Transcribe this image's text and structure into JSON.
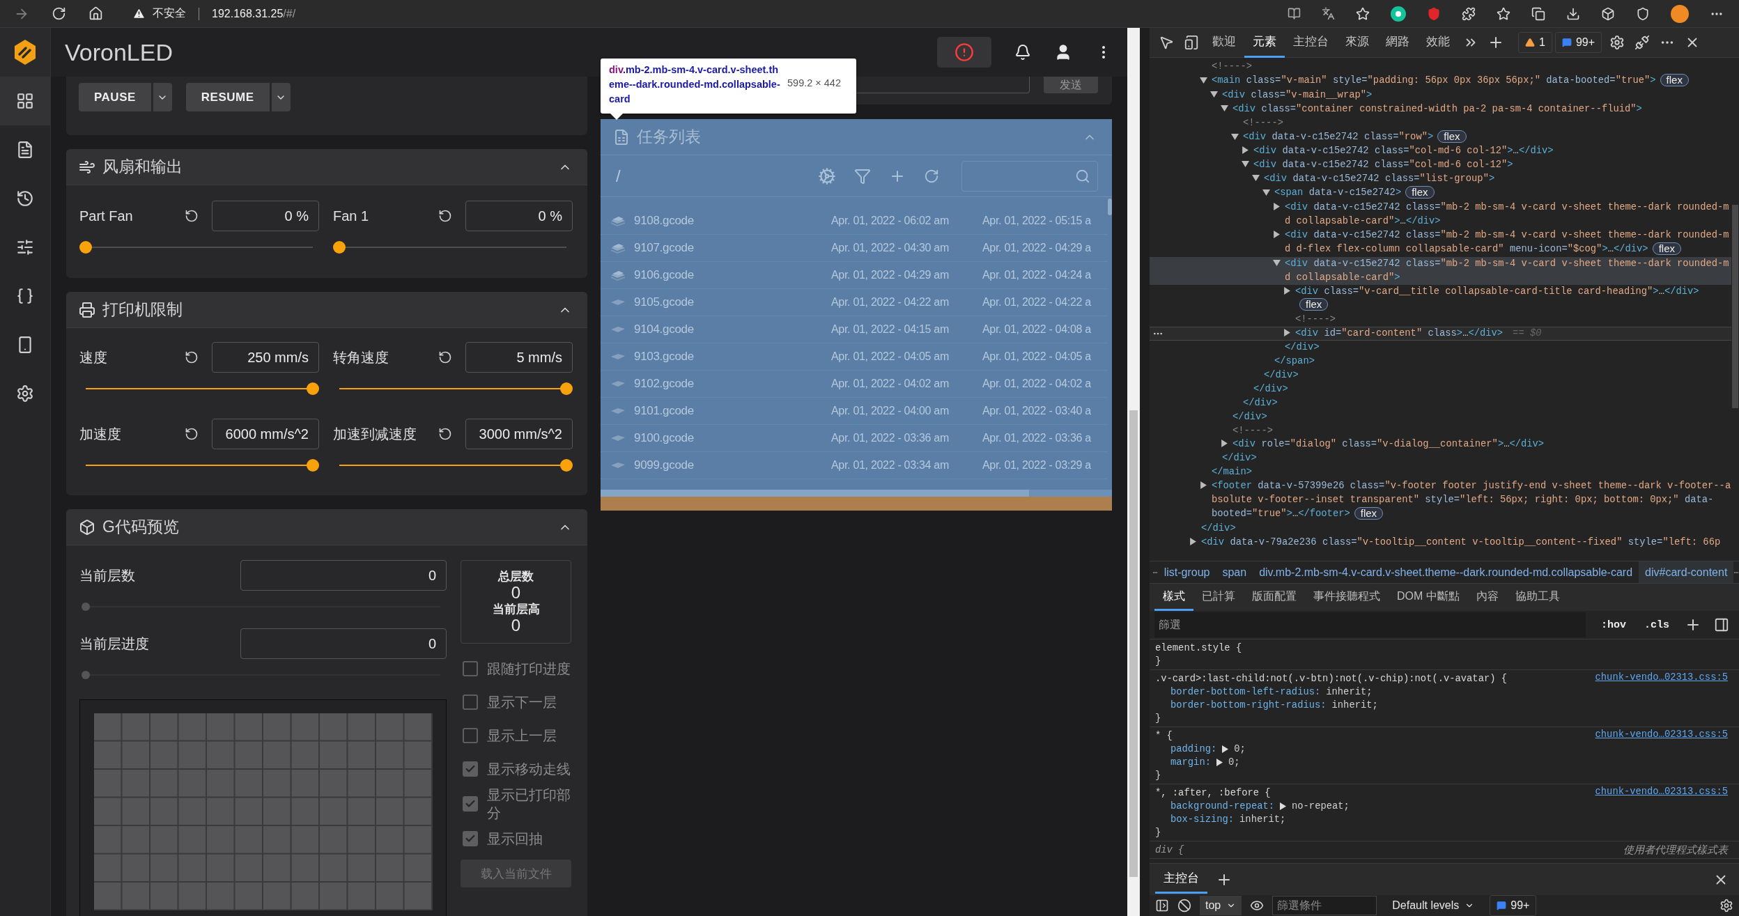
{
  "browser": {
    "warning": "不安全",
    "address_host": "192.168.31.25",
    "address_path": "/#/"
  },
  "app": {
    "title": "VoronLED"
  },
  "sidebar": {
    "items": [
      {
        "kind": "dashboard",
        "selected": true
      },
      {
        "kind": "files",
        "selected": false
      },
      {
        "kind": "history",
        "selected": false
      },
      {
        "kind": "tune",
        "selected": false
      },
      {
        "kind": "macros",
        "selected": false
      },
      {
        "kind": "machine",
        "selected": false
      },
      {
        "kind": "settings",
        "selected": false
      }
    ]
  },
  "print_controls": {
    "buttons": [
      "PAUSE",
      "RESUME"
    ]
  },
  "fans_card": {
    "title": "风扇和输出",
    "expanded": true,
    "controls": [
      {
        "name": "Part Fan",
        "value": "0 %",
        "level": 0,
        "disabled": false
      },
      {
        "name": "Fan 1",
        "value": "0 %",
        "level": 0,
        "disabled": false
      }
    ]
  },
  "limits_card": {
    "title": "打印机限制",
    "expanded": true,
    "controls": [
      {
        "name": "速度",
        "value": "250 mm/s",
        "level": 1,
        "disabled": false
      },
      {
        "name": "转角速度",
        "value": "5 mm/s",
        "level": 1,
        "disabled": false
      },
      {
        "name": "加速度",
        "value": "6000 mm/s^2",
        "level": 1,
        "disabled": false
      },
      {
        "name": "加速到减速度",
        "value": "3000 mm/s^2",
        "level": 1,
        "disabled": false
      }
    ]
  },
  "gcode_card": {
    "title": "G代码预览",
    "expanded": true,
    "fields": [
      {
        "name": "当前层数",
        "value": "0",
        "level": 0,
        "disabled": true
      },
      {
        "name": "当前层进度",
        "value": "0",
        "level": 0,
        "disabled": true
      }
    ],
    "stats": [
      {
        "label": "总层数",
        "value": "0"
      },
      {
        "label": "当前层高",
        "value": "0"
      }
    ],
    "options": [
      {
        "label": "跟随打印进度",
        "checked": false
      },
      {
        "label": "显示下一层",
        "checked": false
      },
      {
        "label": "显示上一层",
        "checked": false
      },
      {
        "label": "显示移动走线",
        "checked": true
      },
      {
        "label": "显示已打印部分",
        "checked": true
      },
      {
        "label": "显示回抽",
        "checked": true
      }
    ],
    "load_button": "载入当前文件"
  },
  "console_card": {
    "send_button": "发送"
  },
  "inspect_tooltip": {
    "tag": "div",
    "classes": ".mb-2.mb-sm-4.v-card.v-sheet.theme--dark.rounded-md.collapsable-card",
    "size": "599.2 × 442"
  },
  "task_list": {
    "title": "任务列表",
    "expanded": true,
    "path": "/",
    "rows": [
      {
        "name": "9108.gcode",
        "column_2": "Apr. 01, 2022 - 06:02 am",
        "column_3": "Apr. 01, 2022 - 05:15 a",
        "kind": "stack"
      },
      {
        "name": "9107.gcode",
        "column_2": "Apr. 01, 2022 - 04:30 am",
        "column_3": "Apr. 01, 2022 - 04:29 a",
        "kind": "stack"
      },
      {
        "name": "9106.gcode",
        "column_2": "Apr. 01, 2022 - 04:29 am",
        "column_3": "Apr. 01, 2022 - 04:24 a",
        "kind": "stack"
      },
      {
        "name": "9105.gcode",
        "column_2": "Apr. 01, 2022 - 04:22 am",
        "column_3": "Apr. 01, 2022 - 04:22 a",
        "kind": "flat"
      },
      {
        "name": "9104.gcode",
        "column_2": "Apr. 01, 2022 - 04:15 am",
        "column_3": "Apr. 01, 2022 - 04:08 a",
        "kind": "flat"
      },
      {
        "name": "9103.gcode",
        "column_2": "Apr. 01, 2022 - 04:05 am",
        "column_3": "Apr. 01, 2022 - 04:05 a",
        "kind": "flat"
      },
      {
        "name": "9102.gcode",
        "column_2": "Apr. 01, 2022 - 04:02 am",
        "column_3": "Apr. 01, 2022 - 04:02 a",
        "kind": "flat"
      },
      {
        "name": "9101.gcode",
        "column_2": "Apr. 01, 2022 - 04:00 am",
        "column_3": "Apr. 01, 2022 - 03:40 a",
        "kind": "flat"
      },
      {
        "name": "9100.gcode",
        "column_2": "Apr. 01, 2022 - 03:36 am",
        "column_3": "Apr. 01, 2022 - 03:36 a",
        "kind": "flat"
      },
      {
        "name": "9099.gcode",
        "column_2": "Apr. 01, 2022 - 03:34 am",
        "column_3": "Apr. 01, 2022 - 03:29 a",
        "kind": "flat"
      }
    ]
  },
  "devtools": {
    "tabs": [
      {
        "label": "歡迎",
        "selected": false
      },
      {
        "label": "元素",
        "selected": true
      },
      {
        "label": "主控台",
        "selected": false
      },
      {
        "label": "來源",
        "selected": false
      },
      {
        "label": "網路",
        "selected": false
      },
      {
        "label": "效能",
        "selected": false
      }
    ],
    "warnings": "1",
    "messages": "99+",
    "dom_tree": [
      {
        "close": "</div>",
        "children": [
          {
            "selected": false,
            "highlighted": false,
            "parts": [
              {
                "kind": "comment",
                "text": "<!---->"
              }
            ]
          },
          {
            "selected": false,
            "highlighted": false,
            "expanded": true,
            "parts": [
              {
                "kind": "tag",
                "text": "<main"
              },
              {
                "kind": "attr",
                "text": " class="
              },
              {
                "kind": "val",
                "text": "\"v-main\""
              },
              {
                "kind": "attr",
                "text": " style="
              },
              {
                "kind": "val",
                "text": "\"padding: 56px 0px 36px 56px;\""
              },
              {
                "kind": "attr",
                "text": " data-booted="
              },
              {
                "kind": "val",
                "text": "\"true\""
              },
              {
                "kind": "tag",
                "text": ">"
              }
            ],
            "badge": "flex",
            "close": "</main>",
            "children": [
              {
                "selected": false,
                "highlighted": false,
                "expanded": true,
                "parts": [
                  {
                    "kind": "tag",
                    "text": "<div"
                  },
                  {
                    "kind": "attr",
                    "text": " class="
                  },
                  {
                    "kind": "val",
                    "text": "\"v-main__wrap\""
                  },
                  {
                    "kind": "tag",
                    "text": ">"
                  }
                ],
                "close": "</div>",
                "children": [
                  {
                    "selected": false,
                    "highlighted": false,
                    "expanded": true,
                    "parts": [
                      {
                        "kind": "tag",
                        "text": "<div"
                      },
                      {
                        "kind": "attr",
                        "text": " class="
                      },
                      {
                        "kind": "val",
                        "text": "\"container constrained-width pa-2 pa-sm-4 container--fluid\""
                      },
                      {
                        "kind": "tag",
                        "text": ">"
                      }
                    ],
                    "close": "</div>",
                    "children": [
                      {
                        "selected": false,
                        "highlighted": false,
                        "parts": [
                          {
                            "kind": "comment",
                            "text": "<!---->"
                          }
                        ]
                      },
                      {
                        "selected": false,
                        "highlighted": false,
                        "expanded": true,
                        "parts": [
                          {
                            "kind": "tag",
                            "text": "<div"
                          },
                          {
                            "kind": "attr",
                            "text": " data-v-c15e2742 class="
                          },
                          {
                            "kind": "val",
                            "text": "\"row\""
                          },
                          {
                            "kind": "tag",
                            "text": ">"
                          }
                        ],
                        "badge": "flex",
                        "close": "</div>",
                        "children": [
                          {
                            "selected": false,
                            "highlighted": false,
                            "expanded": false,
                            "parts": [
                              {
                                "kind": "tag",
                                "text": "<div"
                              },
                              {
                                "kind": "attr",
                                "text": " data-v-c15e2742 class="
                              },
                              {
                                "kind": "val",
                                "text": "\"col-md-6 col-12\""
                              },
                              {
                                "kind": "tag",
                                "text": ">"
                              },
                              {
                                "kind": "plain",
                                "text": "…"
                              },
                              {
                                "kind": "tag",
                                "text": "</div>"
                              }
                            ]
                          },
                          {
                            "selected": false,
                            "highlighted": false,
                            "expanded": true,
                            "parts": [
                              {
                                "kind": "tag",
                                "text": "<div"
                              },
                              {
                                "kind": "attr",
                                "text": " data-v-c15e2742 class="
                              },
                              {
                                "kind": "val",
                                "text": "\"col-md-6 col-12\""
                              },
                              {
                                "kind": "tag",
                                "text": ">"
                              }
                            ],
                            "close": "</div>",
                            "children": [
                              {
                                "selected": false,
                                "highlighted": false,
                                "expanded": true,
                                "parts": [
                                  {
                                    "kind": "tag",
                                    "text": "<div"
                                  },
                                  {
                                    "kind": "attr",
                                    "text": " data-v-c15e2742 class="
                                  },
                                  {
                                    "kind": "val",
                                    "text": "\"list-group\""
                                  },
                                  {
                                    "kind": "tag",
                                    "text": ">"
                                  }
                                ],
                                "close": "</div>",
                                "children": [
                                  {
                                    "selected": false,
                                    "highlighted": false,
                                    "expanded": true,
                                    "parts": [
                                      {
                                        "kind": "tag",
                                        "text": "<span"
                                      },
                                      {
                                        "kind": "attr",
                                        "text": " data-v-c15e2742"
                                      },
                                      {
                                        "kind": "tag",
                                        "text": ">"
                                      }
                                    ],
                                    "badge": "flex",
                                    "close": "</span>",
                                    "children": [
                                      {
                                        "selected": false,
                                        "highlighted": false,
                                        "expanded": false,
                                        "lines": [
                                          [
                                            {
                                              "kind": "tag",
                                              "text": "<div"
                                            },
                                            {
                                              "kind": "attr",
                                              "text": " data-v-c15e2742 class="
                                            },
                                            {
                                              "kind": "val",
                                              "text": "\"mb-2 mb-sm-4 v-card v-sheet theme--dark rounded-m"
                                            }
                                          ],
                                          [
                                            {
                                              "kind": "val",
                                              "text": "d collapsable-card\""
                                            },
                                            {
                                              "kind": "tag",
                                              "text": ">"
                                            },
                                            {
                                              "kind": "plain",
                                              "text": "…"
                                            },
                                            {
                                              "kind": "tag",
                                              "text": "</div>"
                                            }
                                          ]
                                        ]
                                      },
                                      {
                                        "selected": false,
                                        "highlighted": false,
                                        "expanded": false,
                                        "lines": [
                                          [
                                            {
                                              "kind": "tag",
                                              "text": "<div"
                                            },
                                            {
                                              "kind": "attr",
                                              "text": " data-v-c15e2742 class="
                                            },
                                            {
                                              "kind": "val",
                                              "text": "\"mb-2 mb-sm-4 v-card v-sheet theme--dark rounded-m"
                                            }
                                          ],
                                          [
                                            {
                                              "kind": "val",
                                              "text": "d d-flex flex-column collapsable-card\""
                                            },
                                            {
                                              "kind": "attr",
                                              "text": " menu-icon="
                                            },
                                            {
                                              "kind": "val",
                                              "text": "\"$cog\""
                                            },
                                            {
                                              "kind": "tag",
                                              "text": ">"
                                            },
                                            {
                                              "kind": "plain",
                                              "text": "…"
                                            },
                                            {
                                              "kind": "tag",
                                              "text": "</div>"
                                            }
                                          ]
                                        ],
                                        "badge": "flex"
                                      },
                                      {
                                        "selected": false,
                                        "highlighted": true,
                                        "expanded": true,
                                        "lines": [
                                          [
                                            {
                                              "kind": "tag",
                                              "text": "<div"
                                            },
                                            {
                                              "kind": "attr",
                                              "text": " data-v-c15e2742 class="
                                            },
                                            {
                                              "kind": "val",
                                              "text": "\"mb-2 mb-sm-4 v-card v-sheet theme--dark rounded-m"
                                            }
                                          ],
                                          [
                                            {
                                              "kind": "val",
                                              "text": "d collapsable-card\""
                                            },
                                            {
                                              "kind": "tag",
                                              "text": ">"
                                            }
                                          ]
                                        ],
                                        "close": "</div>",
                                        "children": [
                                          {
                                            "selected": false,
                                            "highlighted": false,
                                            "expanded": false,
                                            "parts": [
                                              {
                                                "kind": "tag",
                                                "text": "<div"
                                              },
                                              {
                                                "kind": "attr",
                                                "text": " class="
                                              },
                                              {
                                                "kind": "val",
                                                "text": "\"v-card__title collapsable-card-title card-heading\""
                                              },
                                              {
                                                "kind": "tag",
                                                "text": ">"
                                              },
                                              {
                                                "kind": "plain",
                                                "text": "…"
                                              },
                                              {
                                                "kind": "tag",
                                                "text": "</div>"
                                              }
                                            ],
                                            "badge": "flex"
                                          },
                                          {
                                            "selected": false,
                                            "highlighted": false,
                                            "parts": [
                                              {
                                                "kind": "comment",
                                                "text": "<!---->"
                                              }
                                            ]
                                          },
                                          {
                                            "selected": true,
                                            "highlighted": false,
                                            "expanded": false,
                                            "parts": [
                                              {
                                                "kind": "tag",
                                                "text": "<div"
                                              },
                                              {
                                                "kind": "attr",
                                                "text": " id="
                                              },
                                              {
                                                "kind": "val",
                                                "text": "\"card-content\""
                                              },
                                              {
                                                "kind": "attr",
                                                "text": " class"
                                              },
                                              {
                                                "kind": "tag",
                                                "text": ">"
                                              },
                                              {
                                                "kind": "plain",
                                                "text": "…"
                                              },
                                              {
                                                "kind": "tag",
                                                "text": "</div>"
                                              }
                                            ],
                                            "suffix": "== $0"
                                          }
                                        ]
                                      }
                                    ]
                                  }
                                ]
                              }
                            ]
                          }
                        ]
                      }
                    ]
                  },
                  {
                    "selected": false,
                    "highlighted": false,
                    "parts": [
                      {
                        "kind": "comment",
                        "text": "<!---->"
                      }
                    ]
                  },
                  {
                    "selected": false,
                    "highlighted": false,
                    "expanded": false,
                    "parts": [
                      {
                        "kind": "tag",
                        "text": "<div"
                      },
                      {
                        "kind": "attr",
                        "text": " role="
                      },
                      {
                        "kind": "val",
                        "text": "\"dialog\""
                      },
                      {
                        "kind": "attr",
                        "text": " class="
                      },
                      {
                        "kind": "val",
                        "text": "\"v-dialog__container\""
                      },
                      {
                        "kind": "tag",
                        "text": ">"
                      },
                      {
                        "kind": "plain",
                        "text": "…"
                      },
                      {
                        "kind": "tag",
                        "text": "</div>"
                      }
                    ]
                  }
                ]
              }
            ]
          },
          {
            "selected": false,
            "highlighted": false,
            "expanded": false,
            "lines": [
              [
                {
                  "kind": "tag",
                  "text": "<footer"
                },
                {
                  "kind": "attr",
                  "text": " data-v-57399e26 class="
                },
                {
                  "kind": "val",
                  "text": "\"v-footer footer justify-end v-sheet theme--dark v-footer--a"
                }
              ],
              [
                {
                  "kind": "val",
                  "text": "bsolute v-footer--inset transparent\""
                },
                {
                  "kind": "attr",
                  "text": " style="
                },
                {
                  "kind": "val",
                  "text": "\"left: 56px; right: 0px; bottom: 0px;\""
                },
                {
                  "kind": "attr",
                  "text": " data-"
                }
              ],
              [
                {
                  "kind": "attr",
                  "text": "booted="
                },
                {
                  "kind": "val",
                  "text": "\"true\""
                },
                {
                  "kind": "tag",
                  "text": ">"
                },
                {
                  "kind": "plain",
                  "text": "…"
                },
                {
                  "kind": "tag",
                  "text": "</footer>"
                }
              ]
            ],
            "badge": "flex"
          }
        ]
      },
      {
        "selected": false,
        "highlighted": false,
        "expanded": false,
        "parts": [
          {
            "kind": "tag",
            "text": "<div"
          },
          {
            "kind": "attr",
            "text": " data-v-79a2e236 class="
          },
          {
            "kind": "val",
            "text": "\"v-tooltip__content v-tooltip__content--fixed\""
          },
          {
            "kind": "attr",
            "text": " style="
          },
          {
            "kind": "val",
            "text": "\"left: 66p"
          }
        ]
      }
    ],
    "breadcrumbs": [
      {
        "label": "list-group",
        "selected": false
      },
      {
        "label": "span",
        "selected": false
      },
      {
        "label": "div.mb-2.mb-sm-4.v-card.v-sheet.theme--dark.rounded-md.collapsable-card",
        "selected": false
      },
      {
        "label": "div#card-content",
        "selected": true
      }
    ],
    "style_tabs": [
      {
        "label": "樣式",
        "selected": true
      },
      {
        "label": "已計算",
        "selected": false
      },
      {
        "label": "版面配置",
        "selected": false
      },
      {
        "label": "事件接聽程式",
        "selected": false
      },
      {
        "label": "DOM 中斷點",
        "selected": false
      },
      {
        "label": "內容",
        "selected": false
      },
      {
        "label": "協助工具",
        "selected": false
      }
    ],
    "filter_placeholder": "篩選",
    "hov": ":hov",
    "cls": ".cls",
    "rules": [
      {
        "kind": "inline",
        "selector": "element.style {",
        "close": "}"
      },
      {
        "kind": "author",
        "selector": ".v-card>:last-child:not(.v-btn):not(.v-chip):not(.v-avatar) {",
        "source": "chunk-vendo…02313.css:5",
        "close": "}",
        "props": [
          {
            "name": "border-bottom-left-radius:",
            "value": "inherit;",
            "expandable": false
          },
          {
            "name": "border-bottom-right-radius:",
            "value": "inherit;",
            "expandable": false
          }
        ]
      },
      {
        "kind": "author",
        "selector": "* {",
        "source": "chunk-vendo…02313.css:5",
        "close": "}",
        "props": [
          {
            "name": "padding:",
            "value": "0;",
            "expandable": true
          },
          {
            "name": "margin:",
            "value": "0;",
            "expandable": true
          }
        ]
      },
      {
        "kind": "author",
        "selector": "*, :after, :before {",
        "source": "chunk-vendo…02313.css:5",
        "close": "}",
        "props": [
          {
            "name": "background-repeat:",
            "value": "no-repeat;",
            "expandable": true
          },
          {
            "name": "box-sizing:",
            "value": "inherit;",
            "expandable": false
          }
        ]
      },
      {
        "kind": "ua",
        "selector": "div {",
        "source": "使用者代理程式樣式表"
      }
    ],
    "drawer_tabs": [
      {
        "label": "主控台",
        "selected": true
      }
    ],
    "console": {
      "context": "top",
      "filter_placeholder": "篩選條件",
      "levels": "Default levels",
      "messages": "99+"
    }
  }
}
